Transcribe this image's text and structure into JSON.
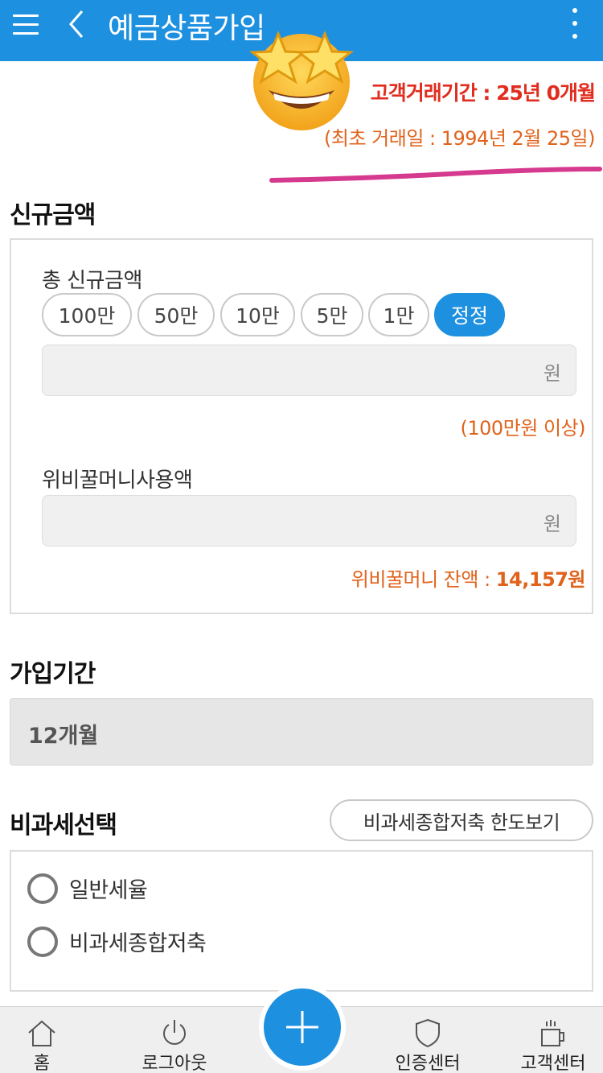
{
  "header": {
    "title": "예금상품가입",
    "menu_icon": "hamburger-icon",
    "back_icon": "chevron-left-icon",
    "more_icon": "kebab-menu-icon",
    "color": "#1e90e0"
  },
  "customer": {
    "tenure": "고객거래기간 : 25년 0개월",
    "first_date": "(최초 거래일 : 1994년 2월 25일)",
    "emoji": "star-struck-emoji"
  },
  "new_amount": {
    "section_title": "신규금액",
    "total_label": "총 신규금액",
    "chips": [
      "100만",
      "50만",
      "10만",
      "5만",
      "1만",
      "정정"
    ],
    "amount_unit": "원",
    "min_note": "(100만원 이상)",
    "honey_label": "위비꿀머니사용액",
    "honey_unit": "원",
    "balance_label": "위비꿀머니 잔액 : ",
    "balance_value": "14,157원"
  },
  "period": {
    "section_title": "가입기간",
    "value": "12개월"
  },
  "tax": {
    "section_title": "비과세선택",
    "limit_button": "비과세종합저축 한도보기",
    "options": [
      "일반세율",
      "비과세종합저축"
    ]
  },
  "bottom_nav": {
    "items": [
      "홈",
      "로그아웃",
      "인증센터",
      "고객센터"
    ],
    "icons": [
      "home-icon",
      "power-icon",
      "shield-icon",
      "cup-icon"
    ],
    "fab_icon": "plus-icon"
  }
}
